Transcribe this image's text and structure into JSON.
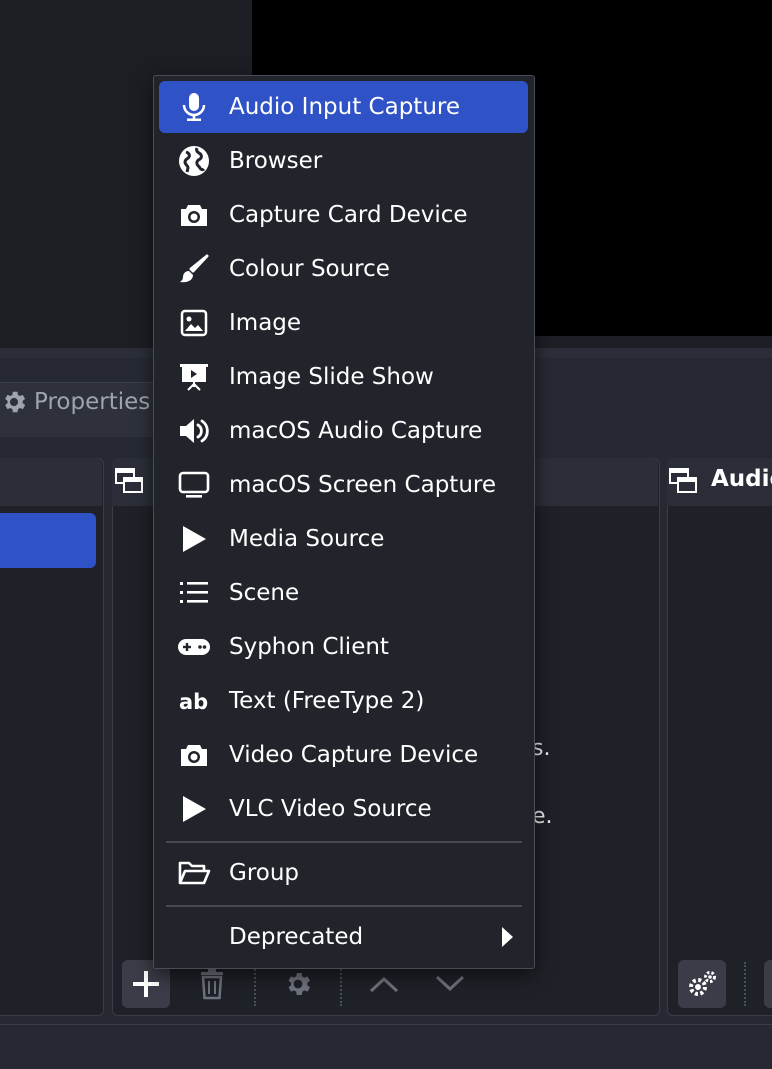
{
  "dock": {
    "properties_label": "Properties",
    "audio_mixer_title": "Audio",
    "hint_line_1": "s.",
    "hint_line_2": "e."
  },
  "context_menu": {
    "items": [
      {
        "label": "Audio Input Capture",
        "icon": "microphone-icon",
        "selected": true
      },
      {
        "label": "Browser",
        "icon": "globe-icon"
      },
      {
        "label": "Capture Card Device",
        "icon": "camera-icon"
      },
      {
        "label": "Colour Source",
        "icon": "paint-brush-icon"
      },
      {
        "label": "Image",
        "icon": "image-icon"
      },
      {
        "label": "Image Slide Show",
        "icon": "slideshow-icon"
      },
      {
        "label": "macOS Audio Capture",
        "icon": "speaker-icon"
      },
      {
        "label": "macOS Screen Capture",
        "icon": "monitor-icon"
      },
      {
        "label": "Media Source",
        "icon": "play-icon"
      },
      {
        "label": "Scene",
        "icon": "list-icon"
      },
      {
        "label": "Syphon Client",
        "icon": "gamepad-icon"
      },
      {
        "label": "Text (FreeType 2)",
        "icon": "text-ab-icon"
      },
      {
        "label": "Video Capture Device",
        "icon": "camera-icon"
      },
      {
        "label": "VLC Video Source",
        "icon": "play-icon"
      }
    ],
    "group_label": "Group",
    "group_icon": "folder-open-icon",
    "deprecated_label": "Deprecated",
    "submenu_icon": "chevron-right-icon"
  },
  "colors": {
    "selection": "#2f53c7",
    "menu_background": "#22242b",
    "panel_background": "#1f2128"
  }
}
